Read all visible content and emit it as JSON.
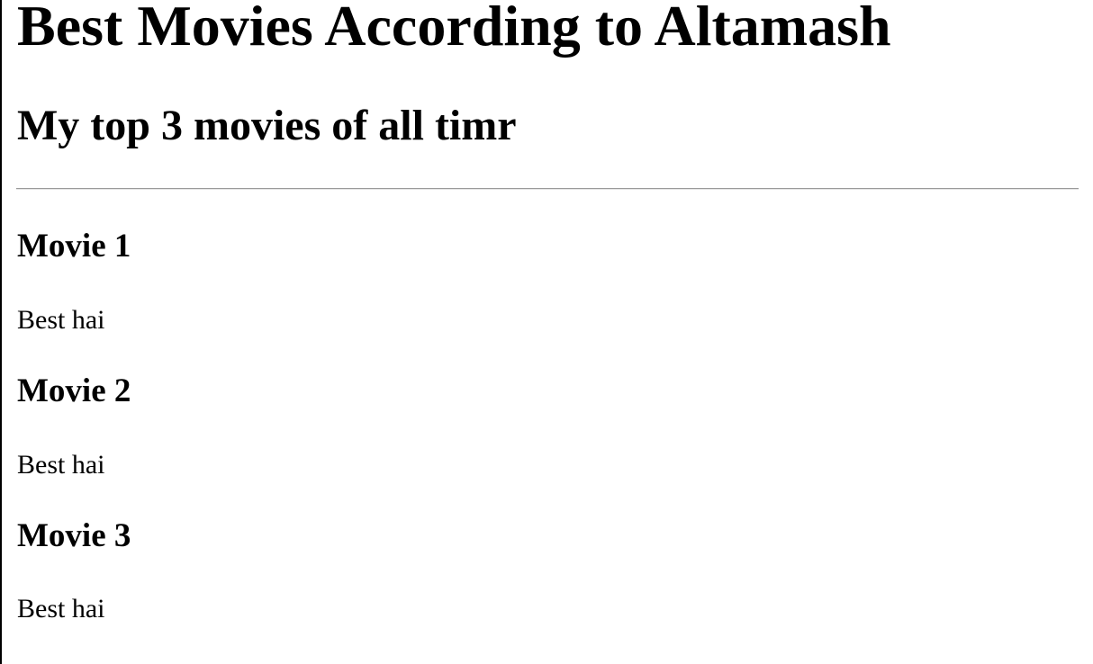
{
  "header": {
    "title": "Best Movies According to Altamash",
    "subtitle": "My top 3 movies of all timr"
  },
  "movies": [
    {
      "title": "Movie 1",
      "description": "Best hai"
    },
    {
      "title": "Movie 2",
      "description": "Best hai"
    },
    {
      "title": "Movie 3",
      "description": "Best hai"
    }
  ]
}
